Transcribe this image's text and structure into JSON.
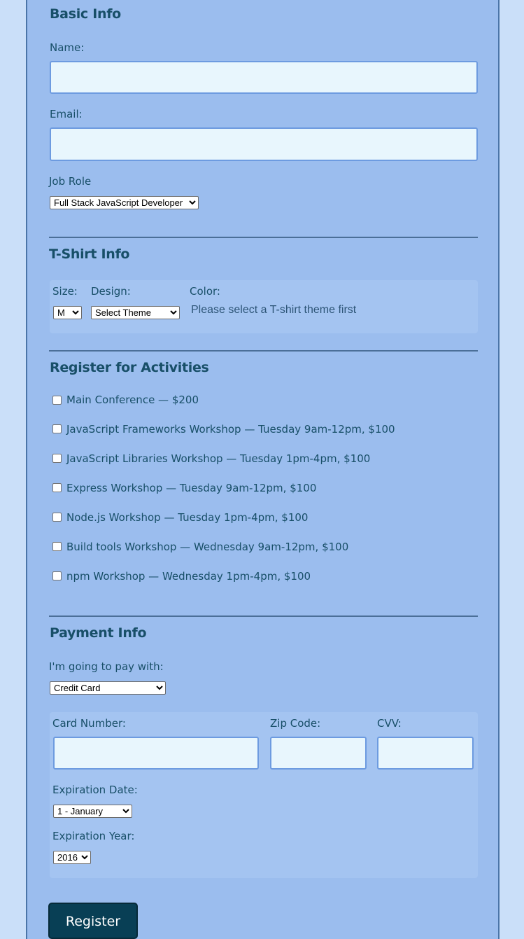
{
  "basic_info": {
    "title": "Basic Info",
    "name_label": "Name:",
    "name_value": "",
    "email_label": "Email:",
    "email_value": "",
    "job_role_label": "Job Role",
    "job_role_selected": "Full Stack JavaScript Developer"
  },
  "tshirt": {
    "title": "T-Shirt Info",
    "size_label": "Size:",
    "size_selected": "M",
    "design_label": "Design:",
    "design_selected": "Select Theme",
    "color_label": "Color:",
    "color_hint": "Please select a T-shirt theme first"
  },
  "activities": {
    "title": "Register for Activities",
    "items": [
      {
        "label": "Main Conference — $200",
        "checked": false
      },
      {
        "label": "JavaScript Frameworks Workshop — Tuesday 9am-12pm, $100",
        "checked": false
      },
      {
        "label": "JavaScript Libraries Workshop — Tuesday 1pm-4pm, $100",
        "checked": false
      },
      {
        "label": "Express Workshop — Tuesday 9am-12pm, $100",
        "checked": false
      },
      {
        "label": "Node.js Workshop — Tuesday 1pm-4pm, $100",
        "checked": false
      },
      {
        "label": "Build tools Workshop — Wednesday 9am-12pm, $100",
        "checked": false
      },
      {
        "label": "npm Workshop — Wednesday 1pm-4pm, $100",
        "checked": false
      }
    ]
  },
  "payment": {
    "title": "Payment Info",
    "pay_with_label": "I'm going to pay with:",
    "pay_with_selected": "Credit Card",
    "card_number_label": "Card Number:",
    "zip_label": "Zip Code:",
    "cvv_label": "CVV:",
    "exp_date_label": "Expiration Date:",
    "exp_date_selected": "1 - January",
    "exp_year_label": "Expiration Year:",
    "exp_year_selected": "2016"
  },
  "register_button": "Register",
  "colors": {
    "page_background": "#cadff9",
    "panel_background": "#9bbdee",
    "heading_text": "#184f68",
    "input_background": "#e8f6fd",
    "button_background": "#083f55"
  }
}
